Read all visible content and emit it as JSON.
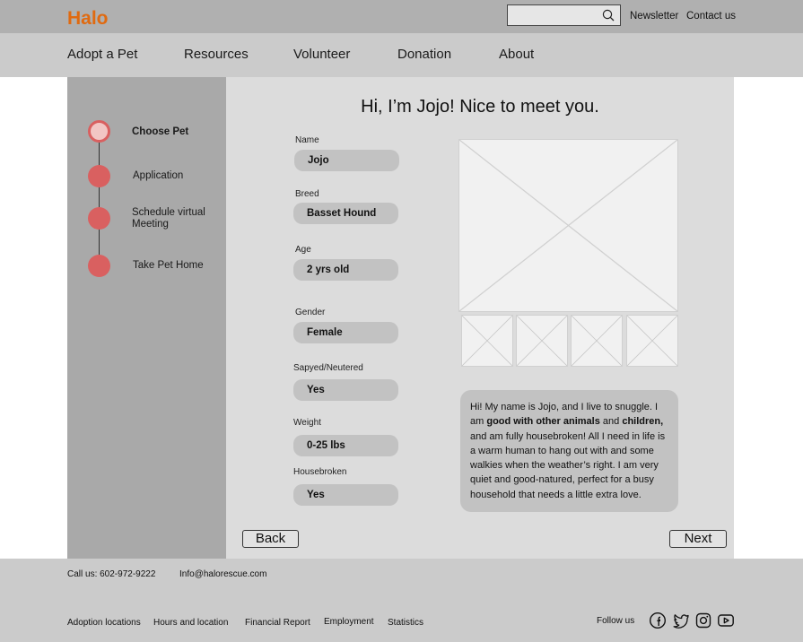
{
  "header": {
    "logo": "Halo",
    "search_placeholder": "",
    "links": [
      "Newsletter",
      "Contact us"
    ]
  },
  "nav": [
    "Adopt a Pet",
    "Resources",
    "Volunteer",
    "Donation",
    "About"
  ],
  "steps": [
    {
      "label": "Choose Pet",
      "active": true
    },
    {
      "label": "Application",
      "active": false
    },
    {
      "label": "Schedule virtual Meeting",
      "active": false
    },
    {
      "label": "Take Pet Home",
      "active": false
    }
  ],
  "main": {
    "title": "Hi, I’m Jojo! Nice to meet you.",
    "fields": [
      {
        "label": "Name",
        "value": "Jojo"
      },
      {
        "label": "Breed",
        "value": "Basset Hound"
      },
      {
        "label": "Age",
        "value": "2 yrs old"
      },
      {
        "label": "Gender",
        "value": "Female"
      },
      {
        "label": "Sapyed/Neutered",
        "value": "Yes"
      },
      {
        "label": "Weight",
        "value": "0-25 lbs"
      },
      {
        "label": "Housebroken",
        "value": "Yes"
      }
    ],
    "bio": {
      "part1": "Hi! My name is Jojo, and I live to snuggle. I am ",
      "bold1": "good with other animals",
      "part2": " and ",
      "bold2": "children,",
      "part3": " and am fully housebroken! All I need in life is a warm human to hang out with and some walkies when the weather’s right. I am very quiet and good-natured, perfect for a busy household that needs a little extra love."
    },
    "back_label": "Back",
    "next_label": "Next"
  },
  "footer": {
    "phone": "Call us: 602-972-9222",
    "email": "Info@halorescue.com",
    "links": [
      "Adoption locations",
      "Hours and location",
      "Financial Report",
      "Employment",
      "Statistics"
    ],
    "follow": "Follow us",
    "social_icons": [
      "facebook-icon",
      "twitter-icon",
      "instagram-icon",
      "youtube-icon"
    ]
  },
  "colors": {
    "brand": "#e06a10",
    "step_dot": "#d96060",
    "step_active_fill": "#f2c6c4"
  }
}
